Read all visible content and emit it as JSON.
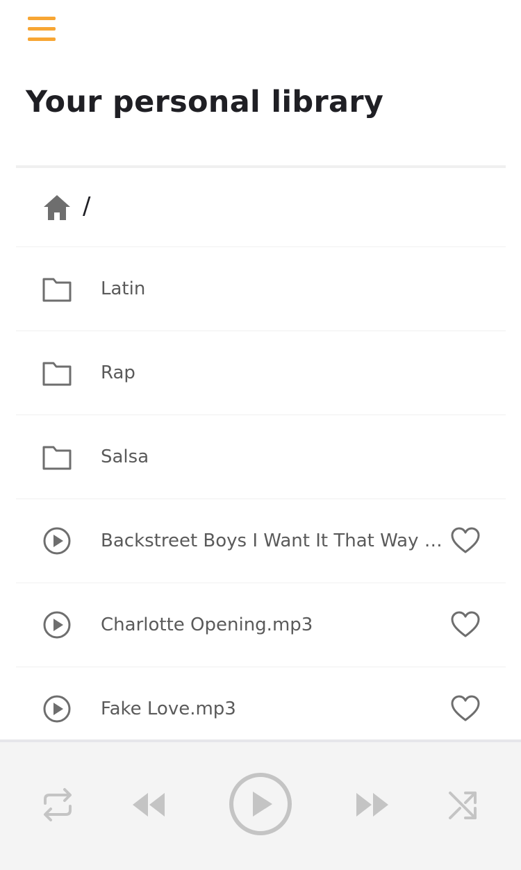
{
  "header": {
    "menu_icon": "hamburger-menu-icon",
    "accent_color": "#f7a634",
    "title": "Your personal library"
  },
  "breadcrumb": {
    "home_icon": "home-icon",
    "path": "/"
  },
  "folders": [
    {
      "name": "Latin",
      "icon": "folder-icon"
    },
    {
      "name": "Rap",
      "icon": "folder-icon"
    },
    {
      "name": "Salsa",
      "icon": "folder-icon"
    }
  ],
  "tracks": [
    {
      "name": "Backstreet Boys I Want It That Way (Offi..",
      "icon": "play-circle-icon",
      "favorite": false
    },
    {
      "name": "Charlotte Opening.mp3",
      "icon": "play-circle-icon",
      "favorite": false
    },
    {
      "name": "Fake Love.mp3",
      "icon": "play-circle-icon",
      "favorite": false
    }
  ],
  "player": {
    "controls": [
      "repeat-icon",
      "rewind-icon",
      "play-icon",
      "fast-forward-icon",
      "shuffle-icon"
    ],
    "icon_color": "#c4c4c4",
    "background": "#f4f4f4"
  }
}
